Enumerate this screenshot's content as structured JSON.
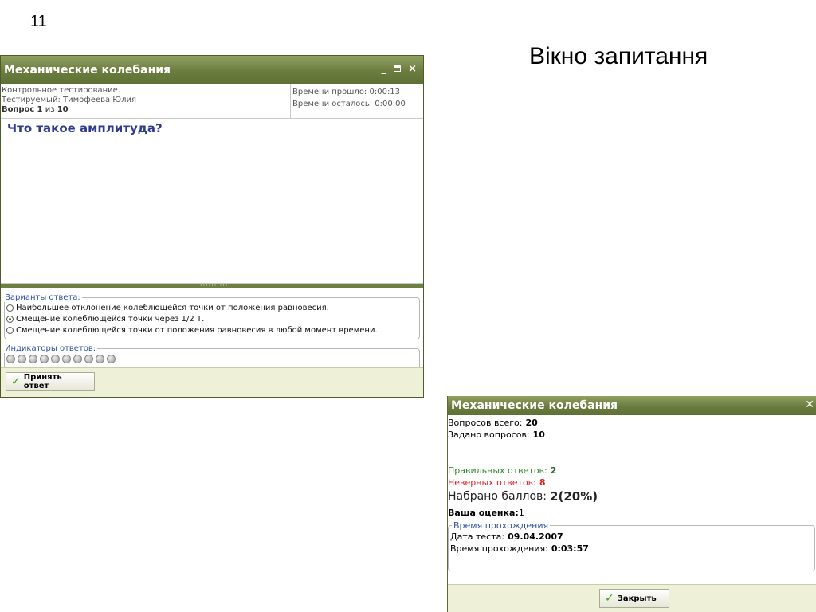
{
  "slide": {
    "number": "11",
    "title": "Вікно запитання"
  },
  "window1": {
    "title": "Механические колебания",
    "info": {
      "test_type": "Контрольное тестирование.",
      "examinee": "Тестируемый: Тимофеева Юлия",
      "question_label": "Вопрос",
      "question_current": "1",
      "question_of": "из",
      "question_total": "10",
      "time_elapsed": "Времени прошло:  0:00:13",
      "time_left": "Времени осталось:  0:00:00"
    },
    "question": "Что такое амплитуда?",
    "answers_legend": "Варианты ответа:",
    "answers": [
      {
        "text": "Наибольшее отклонение колеблющейся точки от положения равновесия.",
        "checked": false
      },
      {
        "text": "Смещение колеблющейся точки через 1/2 Т.",
        "checked": true
      },
      {
        "text": "Смещение колеблющейся точки от положения равновесия в любой момент времени.",
        "checked": false
      }
    ],
    "indicators_legend": "Индикаторы ответов:",
    "indicator_count": 10,
    "accept_button": "Принять ответ"
  },
  "window2": {
    "title": "Механические колебания",
    "total_label": "Вопросов всего:",
    "total_value": "20",
    "asked_label": "Задано вопросов:",
    "asked_value": "10",
    "correct_label": "Правильных ответов:",
    "correct_value": "2",
    "wrong_label": "Неверных ответов:",
    "wrong_value": "8",
    "score_label": "Набрано баллов:",
    "score_value": "2(20%)",
    "grade_label": "Ваша оценка:",
    "grade_value": "1",
    "time_legend": "Время прохождения",
    "date_label": "Дата теста:",
    "date_value": "09.04.2007",
    "duration_label": "Время прохождения:",
    "duration_value": "0:03:57",
    "close_button": "Закрыть"
  },
  "colors": {
    "titlebar": "#6b7c3f",
    "question_text": "#2f3c8c",
    "legend_text": "#2f4f9f",
    "correct": "#2a8a2a",
    "wrong": "#e02020",
    "action_bar": "#eef1d8"
  }
}
